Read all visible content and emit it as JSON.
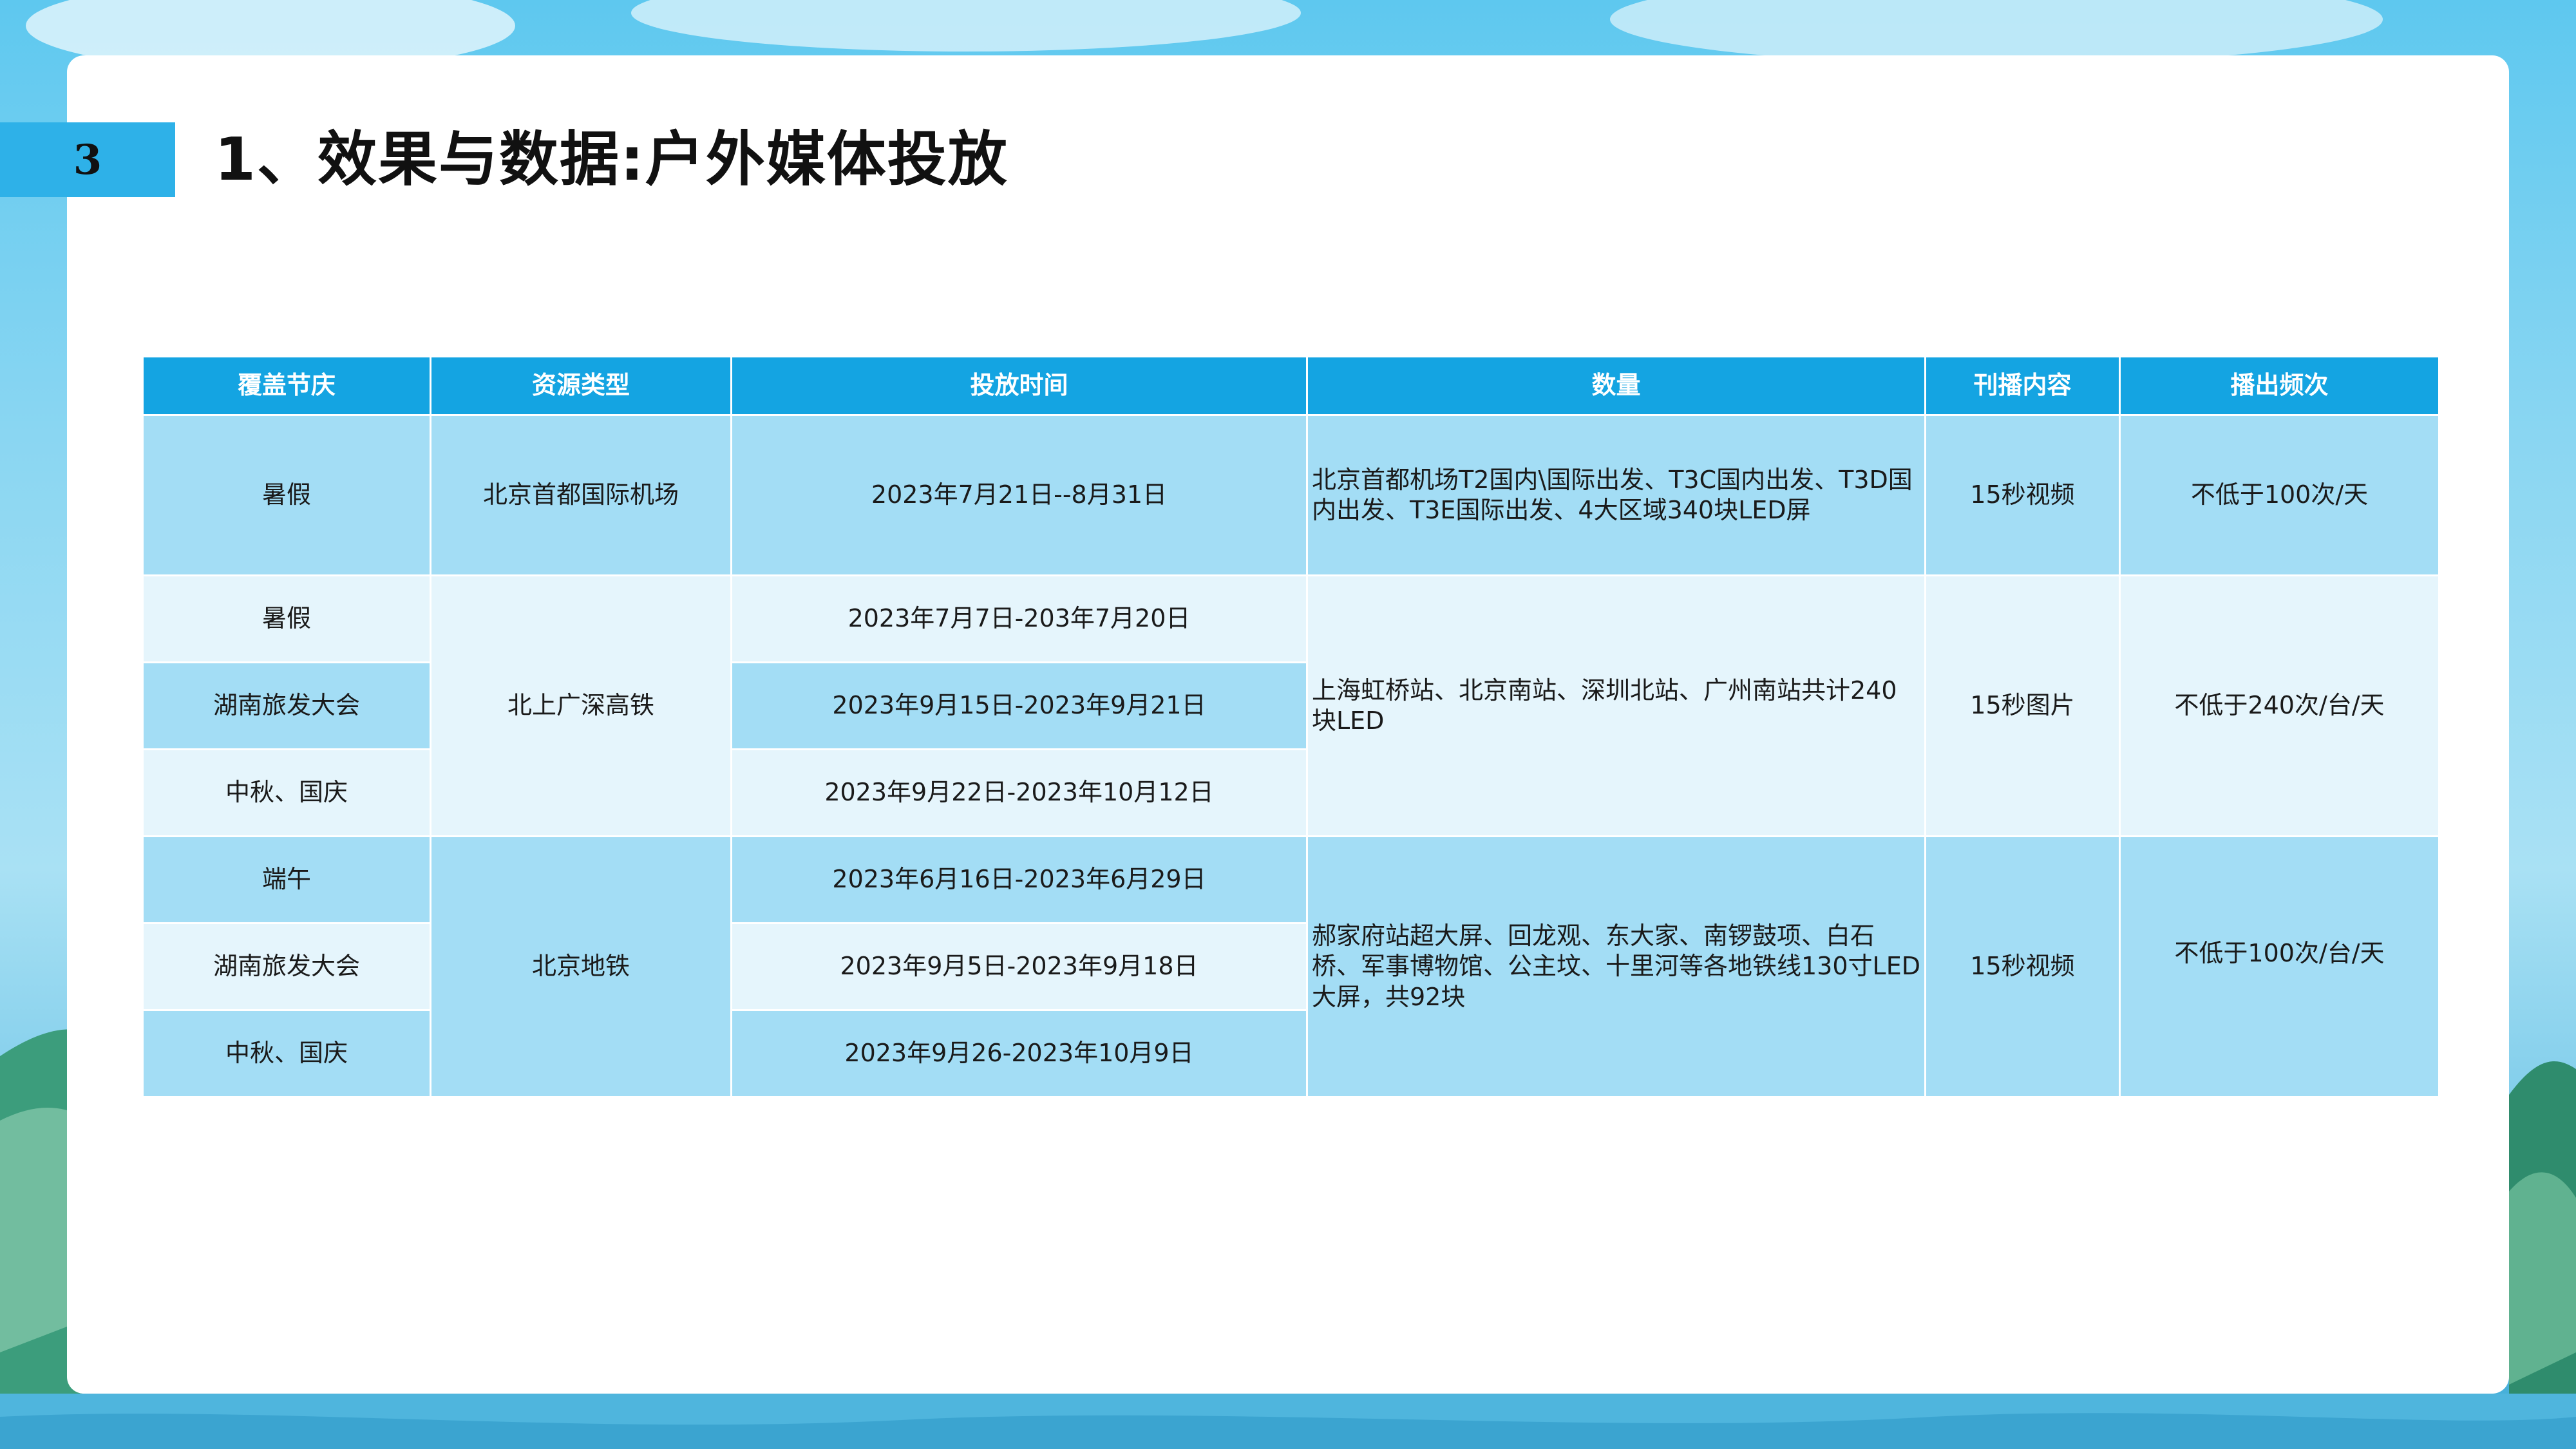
{
  "slide": {
    "number": "3",
    "title": "1、效果与数据:户外媒体投放"
  },
  "table": {
    "headers": [
      "覆盖节庆",
      "资源类型",
      "投放时间",
      "数量",
      "刊播内容",
      "播出频次"
    ],
    "groups": [
      {
        "resource": "北京首都国际机场",
        "quantity": "北京首都机场T2国内\\国际出发、T3C国内出发、T3D国内出发、T3E国际出发、4大区域340块LED屏",
        "content": "15秒视频",
        "frequency": "不低于100次/天",
        "rows": [
          {
            "festival": "暑假",
            "time": "2023年7月21日--8月31日"
          }
        ]
      },
      {
        "resource": "北上广深高铁",
        "quantity": "上海虹桥站、北京南站、深圳北站、广州南站共计240块LED",
        "content": "15秒图片",
        "frequency": "不低于240次/台/天",
        "rows": [
          {
            "festival": "暑假",
            "time": "2023年7月7日-203年7月20日"
          },
          {
            "festival": "湖南旅发大会",
            "time": "2023年9月15日-2023年9月21日"
          },
          {
            "festival": "中秋、国庆",
            "time": "2023年9月22日-2023年10月12日"
          }
        ]
      },
      {
        "resource": "北京地铁",
        "quantity": "郝家府站超大屏、回龙观、东大家、南锣鼓项、白石桥、军事博物馆、公主坟、十里河等各地铁线130寸LED大屏，共92块",
        "content": "15秒视频",
        "frequency": "不低于100次/台/天",
        "rows": [
          {
            "festival": "端午",
            "time": "2023年6月16日-2023年6月29日"
          },
          {
            "festival": "湖南旅发大会",
            "time": "2023年9月5日-2023年9月18日"
          },
          {
            "festival": "中秋、国庆",
            "time": "2023年9月26-2023年10月9日"
          }
        ]
      }
    ]
  }
}
